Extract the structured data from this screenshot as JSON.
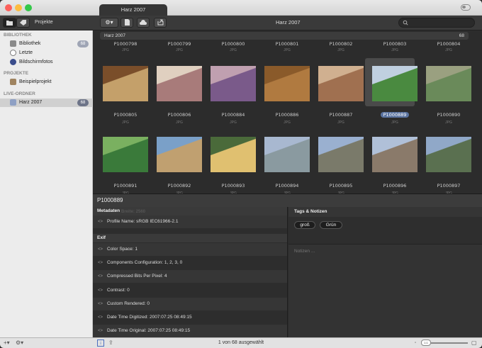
{
  "window": {
    "title": "Harz 2007"
  },
  "toolbar": {
    "projects_label": "Projekte",
    "center_title": "Harz 2007",
    "search_placeholder": ""
  },
  "sidebar": {
    "sections": [
      {
        "label": "BIBLIOTHEK",
        "items": [
          {
            "label": "Bibliothek",
            "badge": "68"
          },
          {
            "label": "Letzte",
            "badge": ""
          },
          {
            "label": "Bildschirmfotos",
            "badge": ""
          }
        ]
      },
      {
        "label": "PROJEKTE",
        "items": [
          {
            "label": "Beispielprojekt",
            "badge": ""
          }
        ]
      },
      {
        "label": "LIVE-ORDNER",
        "items": [
          {
            "label": "Harz 2007",
            "badge": "68"
          }
        ]
      }
    ]
  },
  "grid": {
    "header_title": "Harz 2007",
    "header_count": "68",
    "top_row": [
      {
        "name": "P1000798",
        "type": "JPG"
      },
      {
        "name": "P1000799",
        "type": "JPG"
      },
      {
        "name": "P1000800",
        "type": "JPG"
      },
      {
        "name": "P1000801",
        "type": "JPG"
      },
      {
        "name": "P1000802",
        "type": "JPG"
      },
      {
        "name": "P1000803",
        "type": "JPG"
      },
      {
        "name": "P1000804",
        "type": "JPG"
      }
    ],
    "row1": [
      {
        "name": "P1000805",
        "type": "JPG"
      },
      {
        "name": "P1000806",
        "type": "JPG"
      },
      {
        "name": "P1000884",
        "type": "JPG"
      },
      {
        "name": "P1000886",
        "type": "JPG"
      },
      {
        "name": "P1000887",
        "type": "JPG"
      },
      {
        "name": "P1000889",
        "type": "JPG"
      },
      {
        "name": "P1000890",
        "type": "JPG"
      }
    ],
    "row2": [
      {
        "name": "P1000891",
        "type": "JPG"
      },
      {
        "name": "P1000892",
        "type": "JPG"
      },
      {
        "name": "P1000893",
        "type": "JPG"
      },
      {
        "name": "P1000894",
        "type": "JPG"
      },
      {
        "name": "P1000895",
        "type": "JPG"
      },
      {
        "name": "P1000896",
        "type": "JPG"
      },
      {
        "name": "P1000897",
        "type": "JPG"
      }
    ]
  },
  "detail": {
    "title": "P1000889",
    "metadata_header": "Metadaten",
    "ghost_text": "Breite: 2560",
    "profile_row": "Profile Name: sRGB IEC61966-2.1",
    "exif_header": "Exif",
    "exif_rows": [
      "Color Space: 1",
      "Components Configuration: 1, 2, 3, 0",
      "Compressed Bits Per Pixel: 4",
      "Contrast: 0",
      "Custom Rendered: 0",
      "Date Time Digitized: 2007:07:25 08:49:15",
      "Date Time Original: 2007:07:25 08:49:15"
    ],
    "tags_header": "Tags & Notizen",
    "tags": [
      "groß",
      "Grün"
    ],
    "notes_placeholder": "Notizen ..."
  },
  "status": {
    "text": "1 von 68 ausgewählt",
    "zoom_label": "1:1"
  },
  "icons": {
    "traffic": [
      "#fc605b",
      "#fdbc40",
      "#34c84a"
    ]
  }
}
